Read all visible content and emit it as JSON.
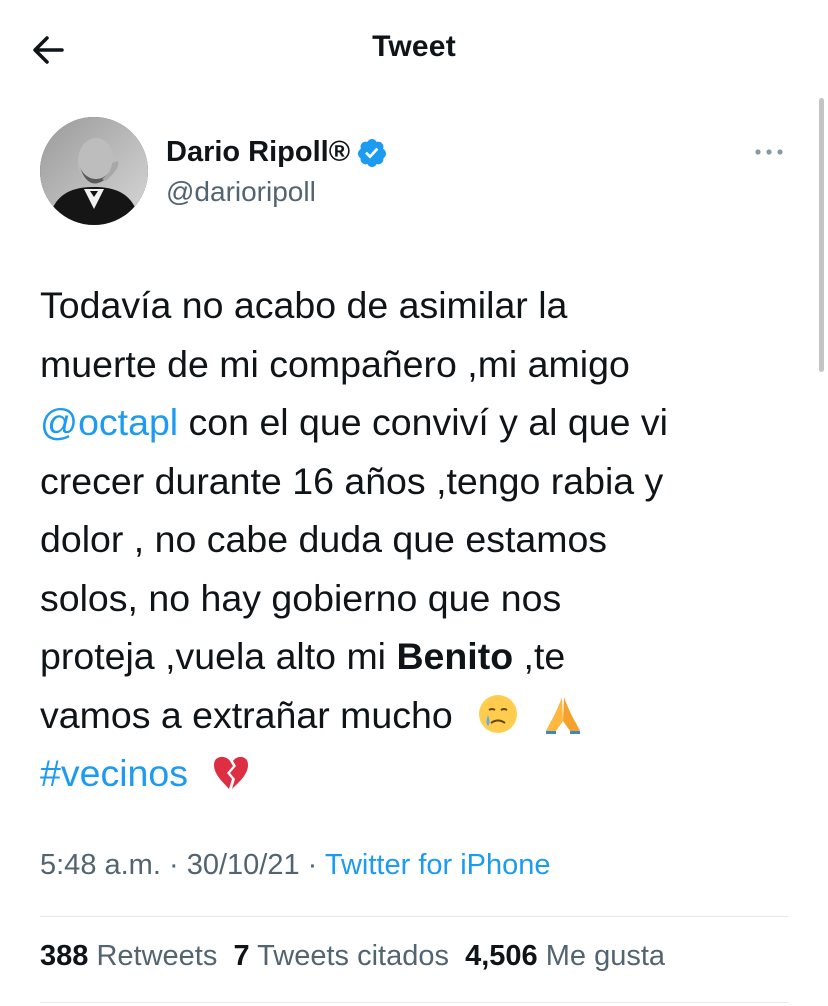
{
  "header": {
    "title": "Tweet",
    "back_icon": "arrow-left-icon"
  },
  "author": {
    "display_name": "Dario Ripoll®",
    "handle": "@darioripoll",
    "verified_icon": "verified-badge-icon",
    "avatar_icon": "avatar-photo"
  },
  "more_icon": "more-options-icon",
  "tweet": {
    "line1": "Todavía no acabo de asimilar la",
    "line2": "muerte de mi compañero ,mi amigo",
    "mention": "@octapl",
    "line3_rest": " con el que  conviví y al que vi",
    "line4": "crecer durante 16 años ,tengo rabia y",
    "line5": "dolor , no cabe duda que estamos",
    "line6": "solos, no hay gobierno que nos",
    "line7_start": "proteja ,vuela alto mi ",
    "bold_name": "Benito",
    "line7_end": " ,te",
    "line8": "vamos a extrañar mucho",
    "hashtag": "#vecinos",
    "emojis": [
      "crying-face-emoji",
      "folded-hands-emoji",
      "broken-heart-emoji"
    ]
  },
  "meta": {
    "time": "5:48 a.m.",
    "date": "30/10/21",
    "separator": "·",
    "source": "Twitter for iPhone"
  },
  "stats": {
    "retweets_count": "388",
    "retweets_label": "Retweets",
    "quotes_count": "7",
    "quotes_label": "Tweets citados",
    "likes_count": "4,506",
    "likes_label": "Me gusta"
  },
  "colors": {
    "link": "#1d9bf0",
    "secondary_text": "#536471",
    "primary_text": "#0f1419"
  }
}
